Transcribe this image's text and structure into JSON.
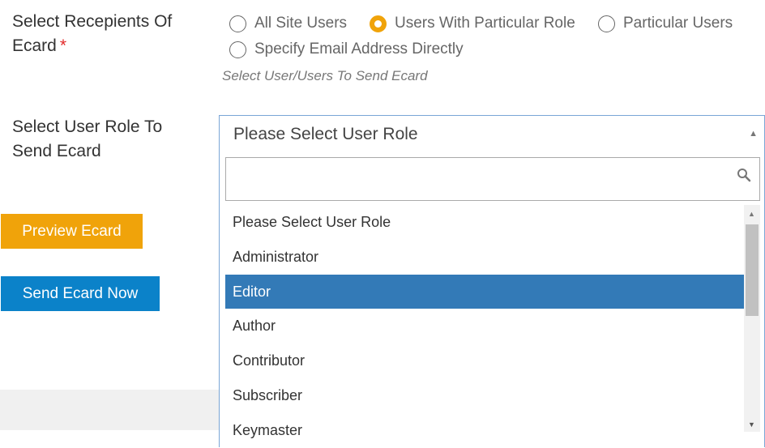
{
  "recipients": {
    "label": "Select Recepients Of Ecard",
    "required_mark": "*",
    "options": [
      {
        "label": "All Site Users",
        "checked": false
      },
      {
        "label": "Users With Particular Role",
        "checked": true
      },
      {
        "label": "Particular Users",
        "checked": false
      },
      {
        "label": "Specify Email Address Directly",
        "checked": false
      }
    ],
    "helper": "Select User/Users To Send Ecard"
  },
  "role": {
    "label": "Select User Role To Send Ecard",
    "selected_value": "Please Select User Role",
    "search_value": "",
    "options": [
      "Please Select User Role",
      "Administrator",
      "Editor",
      "Author",
      "Contributor",
      "Subscriber",
      "Keymaster"
    ],
    "highlighted": "Editor"
  },
  "buttons": {
    "preview": "Preview Ecard",
    "send": "Send Ecard Now"
  },
  "icons": {
    "search": "search-icon",
    "dropdown": "caret-up-icon",
    "scroll_up": "triangle-up-icon",
    "scroll_down": "triangle-down-icon"
  },
  "colors": {
    "accent": "#f0a30a",
    "primary": "#0b82c9",
    "highlight": "#337ab7",
    "required": "#e22a2a"
  }
}
